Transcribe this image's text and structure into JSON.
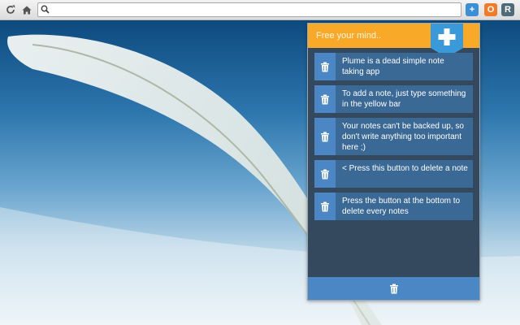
{
  "browser": {
    "toolbar": {
      "refresh_icon": "refresh-icon",
      "home_icon": "home-icon",
      "search_icon": "search-icon"
    },
    "omnibox": {
      "value": ""
    },
    "extensions": [
      {
        "name": "plume-extension",
        "label": "+",
        "color": "#3a8fd6"
      },
      {
        "name": "orange-extension",
        "label": "O",
        "color": "#f07b2a"
      },
      {
        "name": "r-extension",
        "label": "R",
        "color": "#4f6b7a"
      }
    ]
  },
  "plume": {
    "note_input": {
      "placeholder": "Free your mind.."
    },
    "add_button_icon": "plus-icon",
    "notes": [
      {
        "text": "Plume is a dead simple note taking app"
      },
      {
        "text": "To add a note, just type something in the yellow bar"
      },
      {
        "text": "Your notes can't be backed up, so don't write anything too important here ;)"
      },
      {
        "text": "< Press this button to delete a note"
      },
      {
        "text": "Press the button at the bottom to delete every notes"
      }
    ],
    "delete_icon": "trash-icon",
    "footer_icon": "trash-icon",
    "colors": {
      "accent_yellow": "#f9a928",
      "panel_bg": "#34495e",
      "note_bg": "#3b6996",
      "button_blue": "#4a87c4"
    }
  }
}
